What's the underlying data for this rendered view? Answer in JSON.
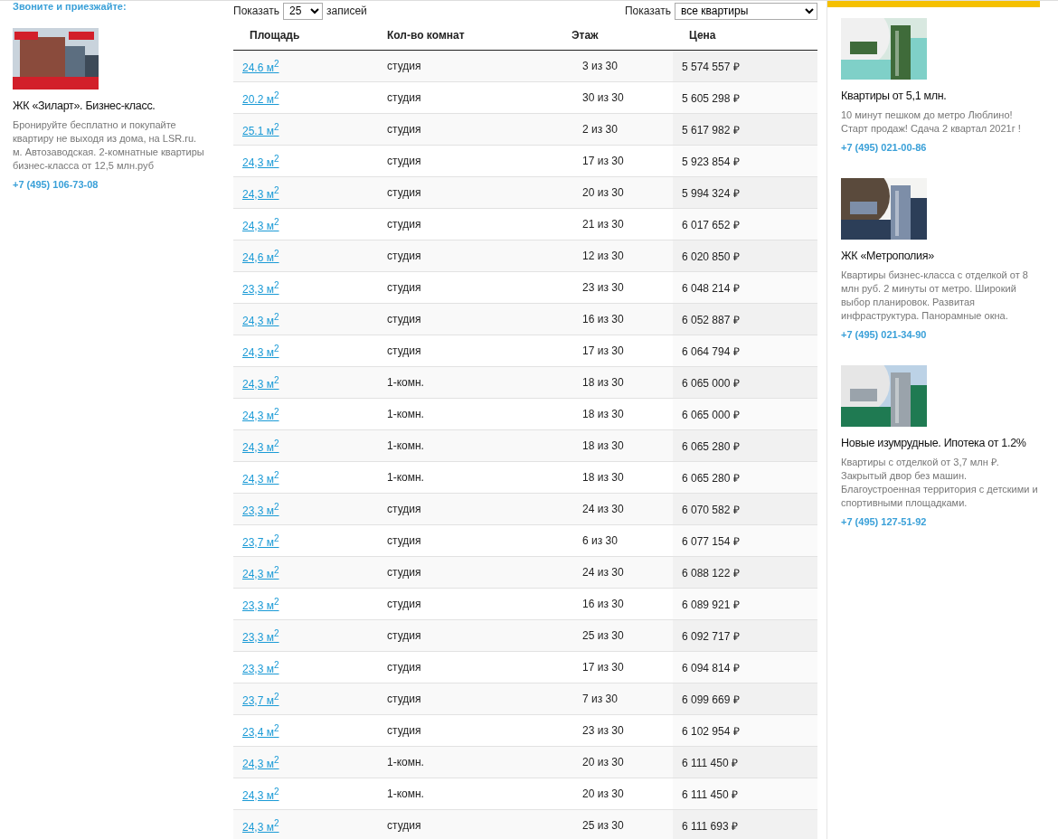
{
  "left_ad": {
    "cut_text": "Звоните и приезжайте:",
    "title": "ЖК «Зиларт». Бизнес-класс.",
    "description": "Бронируйте бесплатно и покупайте квартиру не выходя из дома, на LSR.ru. м. Автозаводская. 2-комнатные квартиры бизнес-класса от 12,5 млн.руб",
    "phone": "+7 (495) 106-73-08"
  },
  "controls": {
    "show_label": "Показать",
    "page_size": "25",
    "records_label": "записей",
    "filter_label": "Показать",
    "filter": "все квартиры"
  },
  "table": {
    "columns": [
      "Площадь",
      "Кол-во комнат",
      "Этаж",
      "Цена"
    ],
    "rows": [
      {
        "area": "24.6 м$^{2}$",
        "rooms": "студия",
        "floor": "3 из 30",
        "price": "5 574 557 ₽"
      },
      {
        "area": "20.2 м$^{2}$",
        "rooms": "студия",
        "floor": "30 из 30",
        "price": "5 605 298 ₽"
      },
      {
        "area": "25.1 м$^{2}$",
        "rooms": "студия",
        "floor": "2 из 30",
        "price": "5 617 982 ₽"
      },
      {
        "area": "24,3 м$^{2}$",
        "rooms": "студия",
        "floor": "17 из 30",
        "price": "5 923 854 ₽"
      },
      {
        "area": "24,3 м$^{2}$",
        "rooms": "студия",
        "floor": "20 из 30",
        "price": "5 994 324 ₽"
      },
      {
        "area": "24,3 м$^{2}$",
        "rooms": "студия",
        "floor": "21 из 30",
        "price": "6 017 652 ₽"
      },
      {
        "area": "24,6 м$^{2}$",
        "rooms": "студия",
        "floor": "12 из 30",
        "price": "6 020 850 ₽"
      },
      {
        "area": "23,3 м$^{2}$",
        "rooms": "студия",
        "floor": "23 из 30",
        "price": "6 048 214 ₽"
      },
      {
        "area": "24,3 м$^{2}$",
        "rooms": "студия",
        "floor": "16 из 30",
        "price": "6 052 887 ₽"
      },
      {
        "area": "24,3 м$^{2}$",
        "rooms": "студия",
        "floor": "17 из 30",
        "price": "6 064 794 ₽"
      },
      {
        "area": "24,3 м$^{2}$",
        "rooms": "1-комн.",
        "floor": "18 из 30",
        "price": "6 065 000 ₽"
      },
      {
        "area": "24,3 м$^{2}$",
        "rooms": "1-комн.",
        "floor": "18 из 30",
        "price": "6 065 000 ₽"
      },
      {
        "area": "24,3 м$^{2}$",
        "rooms": "1-комн.",
        "floor": "18 из 30",
        "price": "6 065 280 ₽"
      },
      {
        "area": "24,3 м$^{2}$",
        "rooms": "1-комн.",
        "floor": "18 из 30",
        "price": "6 065 280 ₽"
      },
      {
        "area": "23,3 м$^{2}$",
        "rooms": "студия",
        "floor": "24 из 30",
        "price": "6 070 582 ₽"
      },
      {
        "area": "23,7 м$^{2}$",
        "rooms": "студия",
        "floor": "6 из 30",
        "price": "6 077 154 ₽"
      },
      {
        "area": "24,3 м$^{2}$",
        "rooms": "студия",
        "floor": "24 из 30",
        "price": "6 088 122 ₽"
      },
      {
        "area": "23,3 м$^{2}$",
        "rooms": "студия",
        "floor": "16 из 30",
        "price": "6 089 921 ₽"
      },
      {
        "area": "23,3 м$^{2}$",
        "rooms": "студия",
        "floor": "25 из 30",
        "price": "6 092 717 ₽"
      },
      {
        "area": "23,3 м$^{2}$",
        "rooms": "студия",
        "floor": "17 из 30",
        "price": "6 094 814 ₽"
      },
      {
        "area": "23,7 м$^{2}$",
        "rooms": "студия",
        "floor": "7 из 30",
        "price": "6 099 669 ₽"
      },
      {
        "area": "23,4 м$^{2}$",
        "rooms": "студия",
        "floor": "23 из 30",
        "price": "6 102 954 ₽"
      },
      {
        "area": "24,3 м$^{2}$",
        "rooms": "1-комн.",
        "floor": "20 из 30",
        "price": "6 111 450 ₽"
      },
      {
        "area": "24,3 м$^{2}$",
        "rooms": "1-комн.",
        "floor": "20 из 30",
        "price": "6 111 450 ₽"
      },
      {
        "area": "24,3 м$^{2}$",
        "rooms": "студия",
        "floor": "25 из 30",
        "price": "6 111 693 ₽"
      }
    ]
  },
  "right_ads": [
    {
      "title": "Квартиры от 5,1 млн.",
      "description": "10 минут пешком до метро Люблино! Старт продаж! Сдача 2 квартал 2021г !",
      "phone": "+7 (495) 021-00-86"
    },
    {
      "title": "ЖК «Метрополия»",
      "description": "Квартиры бизнес-класса с отделкой от 8 млн руб. 2 минуты от метро. Широкий выбор планировок. Развитая инфраструктура. Панорамные окна.",
      "phone": "+7 (495) 021-34-90"
    },
    {
      "title": "Новые изумрудные. Ипотека от 1.2%",
      "description": "Квартиры с отделкой от 3,7 млн ₽. Закрытый двор без машин. Благоустроенная территория с детскими и спортивными площадками.",
      "phone": "+7 (495) 127-51-92"
    }
  ]
}
